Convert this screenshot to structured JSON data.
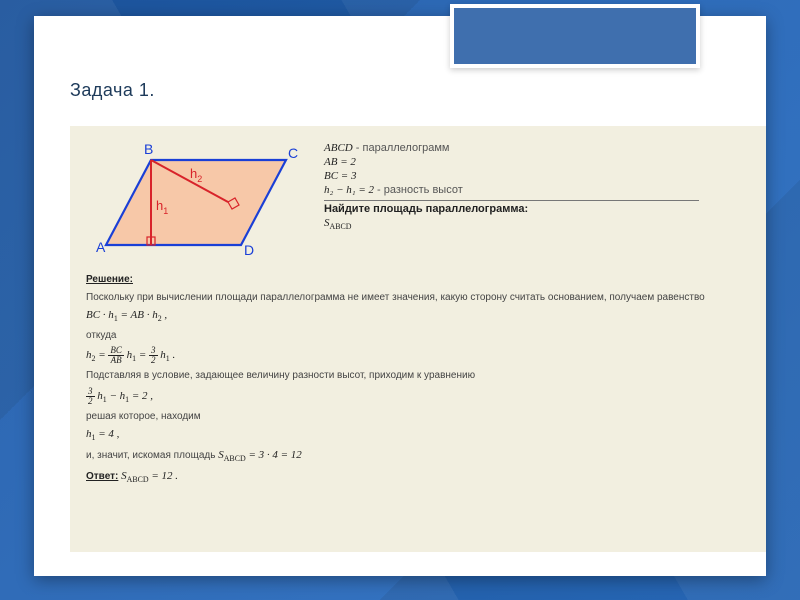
{
  "title": "Задача 1.",
  "diagram": {
    "A": "A",
    "B": "B",
    "C": "C",
    "D": "D",
    "h1": "h1",
    "h2": "h2"
  },
  "given": {
    "l1_math": "ABCD",
    "l1_text": " - параллелограмм",
    "l2": "AB = 2",
    "l3": "BC = 3",
    "l4_math": "h₂ − h₁ = 2",
    "l4_text": " - разность высот",
    "find": "Найдите площадь параллелограмма:",
    "target": "S",
    "target_sub": "ABCD"
  },
  "solution": {
    "header": "Решение:",
    "p1": "Поскольку при вычислении площади параллелограмма не имеет значения, какую сторону считать основанием, получаем равенство",
    "eq1_left": "BC · h",
    "eq1_left_sub": "1",
    "eq1_right": "AB · h",
    "eq1_right_sub": "2",
    "p2": "откуда",
    "eq2_lhs": "h",
    "eq2_lhs_sub": "2",
    "eq2_frac_n": "BC",
    "eq2_frac_d": "AB",
    "eq2_mid": "h",
    "eq2_mid_sub": "1",
    "eq2_frac2_n": "3",
    "eq2_frac2_d": "2",
    "eq2_rhs": "h",
    "eq2_rhs_sub": "1",
    "p3": "Подставляя в условие, задающее величину разности высот, приходим к уравнению",
    "eq3_frac_n": "3",
    "eq3_frac_d": "2",
    "eq3_a": "h",
    "eq3_a_sub": "1",
    "eq3_b": "h",
    "eq3_b_sub": "1",
    "eq3_rhs": "2",
    "p4": "решая которое, находим",
    "eq4": "h",
    "eq4_sub": "1",
    "eq4_val": "4",
    "p5_a": "и, значит, искомая площадь ",
    "p5_S": "S",
    "p5_S_sub": "ABCD",
    "p5_val": " = 3 · 4 = 12",
    "answer_label": "Ответ:",
    "answer_S": "S",
    "answer_S_sub": "ABCD",
    "answer_val": " = 12"
  }
}
